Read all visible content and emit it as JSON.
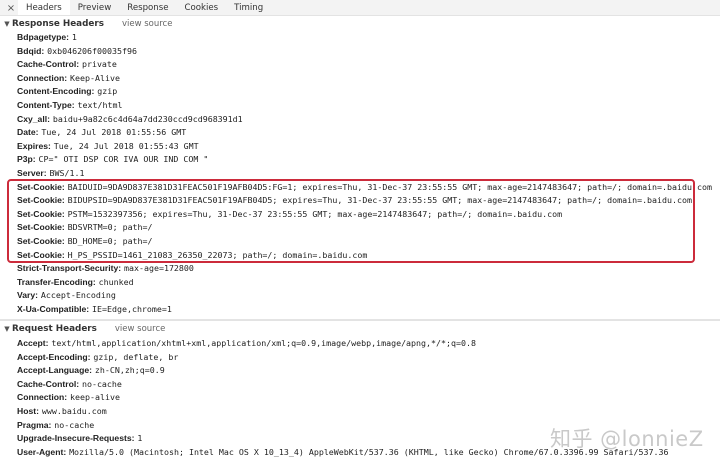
{
  "tabs": {
    "close_glyph": "×",
    "items": [
      "Headers",
      "Preview",
      "Response",
      "Cookies",
      "Timing"
    ],
    "active": "Headers"
  },
  "response_headers": {
    "title": "Response Headers",
    "view_source": "view source",
    "rows": [
      {
        "key": "Bdpagetype:",
        "value": "1"
      },
      {
        "key": "Bdqid:",
        "value": "0xb046206f00035f96"
      },
      {
        "key": "Cache-Control:",
        "value": "private"
      },
      {
        "key": "Connection:",
        "value": "Keep-Alive"
      },
      {
        "key": "Content-Encoding:",
        "value": "gzip"
      },
      {
        "key": "Content-Type:",
        "value": "text/html"
      },
      {
        "key": "Cxy_all:",
        "value": "baidu+9a82c6c4d64a7dd230ccd9cd968391d1"
      },
      {
        "key": "Date:",
        "value": "Tue, 24 Jul 2018 01:55:56 GMT"
      },
      {
        "key": "Expires:",
        "value": "Tue, 24 Jul 2018 01:55:43 GMT"
      },
      {
        "key": "P3p:",
        "value": "CP=\" OTI DSP COR IVA OUR IND COM \""
      },
      {
        "key": "Server:",
        "value": "BWS/1.1"
      },
      {
        "key": "Set-Cookie:",
        "value": "BAIDUID=9DA9D837E381D31FEAC501F19AFB04D5:FG=1; expires=Thu, 31-Dec-37 23:55:55 GMT; max-age=2147483647; path=/; domain=.baidu.com"
      },
      {
        "key": "Set-Cookie:",
        "value": "BIDUPSID=9DA9D837E381D31FEAC501F19AFB04D5; expires=Thu, 31-Dec-37 23:55:55 GMT; max-age=2147483647; path=/; domain=.baidu.com"
      },
      {
        "key": "Set-Cookie:",
        "value": "PSTM=1532397356; expires=Thu, 31-Dec-37 23:55:55 GMT; max-age=2147483647; path=/; domain=.baidu.com"
      },
      {
        "key": "Set-Cookie:",
        "value": "BDSVRTM=0; path=/"
      },
      {
        "key": "Set-Cookie:",
        "value": "BD_HOME=0; path=/"
      },
      {
        "key": "Set-Cookie:",
        "value": "H_PS_PSSID=1461_21083_26350_22073; path=/; domain=.baidu.com"
      },
      {
        "key": "Strict-Transport-Security:",
        "value": "max-age=172800"
      },
      {
        "key": "Transfer-Encoding:",
        "value": "chunked"
      },
      {
        "key": "Vary:",
        "value": "Accept-Encoding"
      },
      {
        "key": "X-Ua-Compatible:",
        "value": "IE=Edge,chrome=1"
      }
    ]
  },
  "request_headers": {
    "title": "Request Headers",
    "view_source": "view source",
    "rows": [
      {
        "key": "Accept:",
        "value": "text/html,application/xhtml+xml,application/xml;q=0.9,image/webp,image/apng,*/*;q=0.8"
      },
      {
        "key": "Accept-Encoding:",
        "value": "gzip, deflate, br"
      },
      {
        "key": "Accept-Language:",
        "value": "zh-CN,zh;q=0.9"
      },
      {
        "key": "Cache-Control:",
        "value": "no-cache"
      },
      {
        "key": "Connection:",
        "value": "keep-alive"
      },
      {
        "key": "Host:",
        "value": "www.baidu.com"
      },
      {
        "key": "Pragma:",
        "value": "no-cache"
      },
      {
        "key": "Upgrade-Insecure-Requests:",
        "value": "1"
      },
      {
        "key": "User-Agent:",
        "value": "Mozilla/5.0 (Macintosh; Intel Mac OS X 10_13_4) AppleWebKit/537.36 (KHTML, like Gecko) Chrome/67.0.3396.99 Safari/537.36"
      }
    ]
  },
  "watermark": "知乎 @lonnieZ",
  "colors": {
    "highlight": "#cc2b3b",
    "active_tab": "#3879d9"
  }
}
